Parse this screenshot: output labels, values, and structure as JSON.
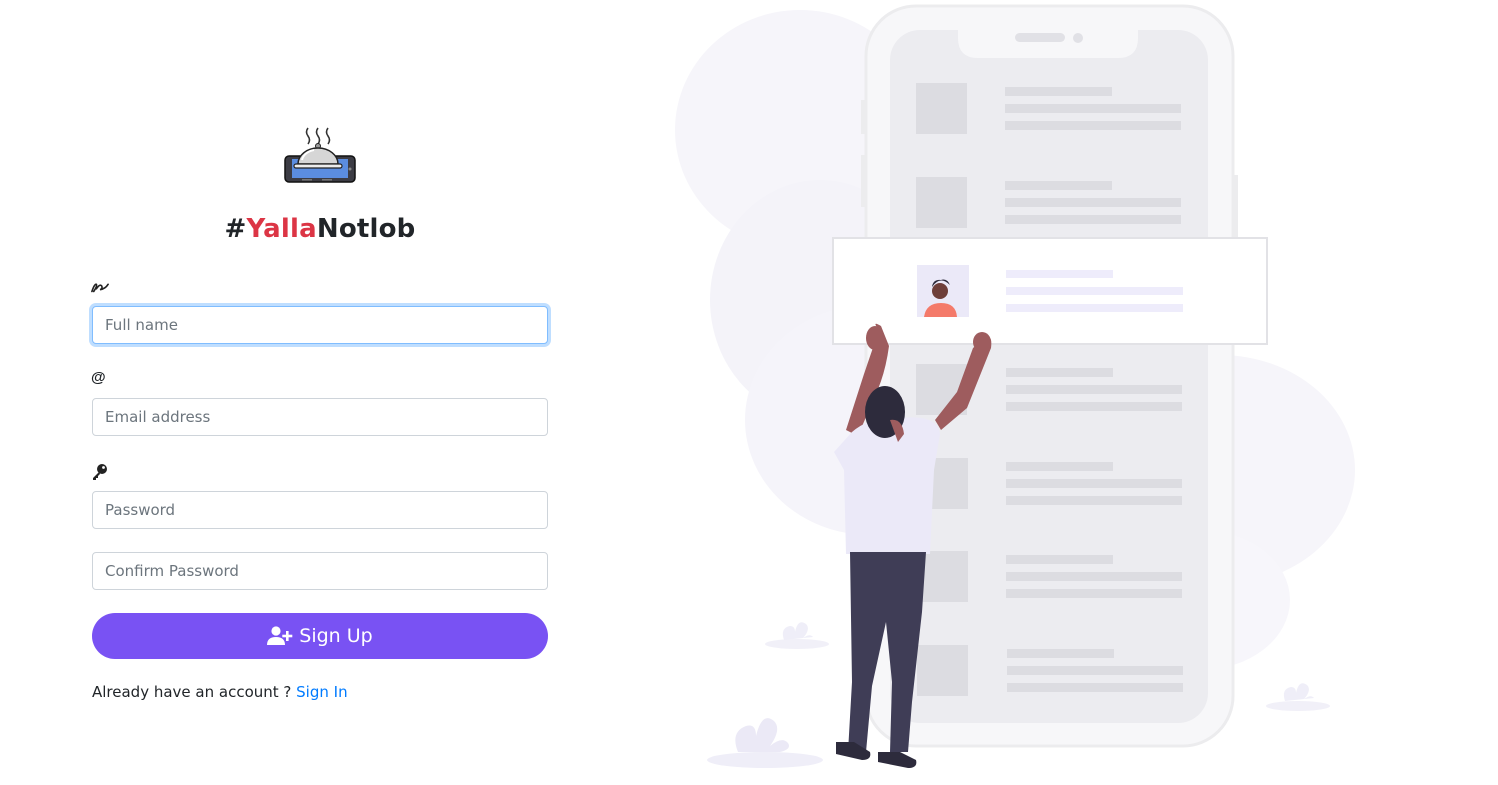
{
  "brand": {
    "prefix": "#",
    "accent": "Yalla",
    "suffix": "Notlob",
    "accent_color": "#dc3545",
    "logo_icon": "serving-dish-phone-icon"
  },
  "form": {
    "name_icon": "signature-icon",
    "full_name_placeholder": "Full name",
    "email_icon": "at-sign-icon",
    "email_icon_glyph": "@",
    "email_placeholder": "Email address",
    "password_icon": "key-icon",
    "password_placeholder": "Password",
    "confirm_password_placeholder": "Confirm Password",
    "signup_label": "Sign Up",
    "signup_icon": "user-plus-icon",
    "signup_color": "#7952f3"
  },
  "footer": {
    "prompt": "Already have an account ? ",
    "signin_label": "Sign In",
    "link_color": "#007bff"
  },
  "illustration": {
    "name": "phone-user-illustration"
  }
}
